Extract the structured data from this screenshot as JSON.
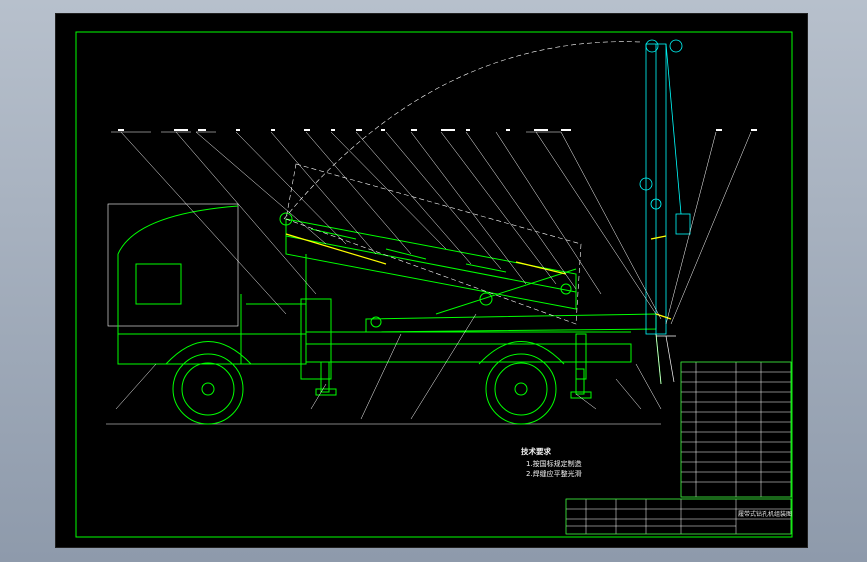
{
  "drawing": {
    "tech_requirements_title": "技术要求",
    "tech_requirements": [
      "1.按国标规定制造",
      "2.焊缝应平整光滑"
    ],
    "title_block_name": "履带式钻孔机组装图"
  },
  "colors": {
    "frame": "#00ff00",
    "machine": "#00ff00",
    "leader": "#ffffff",
    "text": "#f2f2f2",
    "highlight": "#ffff00",
    "cyan": "#00ffff"
  }
}
